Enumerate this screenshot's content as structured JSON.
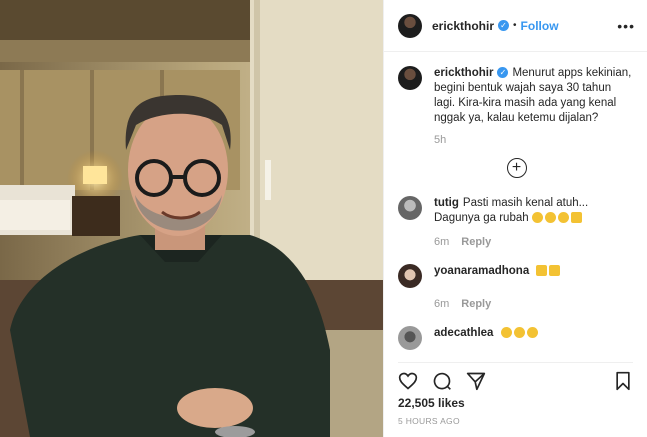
{
  "header": {
    "username": "erickthohir",
    "separator": "•",
    "follow_label": "Follow",
    "more_label": "•••"
  },
  "caption": {
    "username": "erickthohir",
    "text": "Menurut apps kekinian, begini bentuk wajah saya 30 tahun lagi. Kira-kira masih ada yang kenal nggak ya, kalau ketemu dijalan?",
    "time": "5h"
  },
  "load_more_label": "+",
  "comments": [
    {
      "username": "tutig",
      "text": "Pasti masih kenal atuh... Dagunya ga rubah",
      "time": "6m",
      "reply_label": "Reply"
    },
    {
      "username": "yoanaramadhona",
      "text": "",
      "time": "6m",
      "reply_label": "Reply"
    },
    {
      "username": "adecathlea",
      "text": "",
      "time": "",
      "reply_label": ""
    }
  ],
  "likes": "22,505 likes",
  "posted_ago": "5 HOURS AGO",
  "icons": [
    "verified-icon",
    "heart-icon",
    "comment-icon",
    "share-icon",
    "bookmark-icon",
    "plus-circle-icon"
  ],
  "colors": {
    "link_blue": "#3897f0",
    "muted": "#999999",
    "text": "#262626"
  }
}
